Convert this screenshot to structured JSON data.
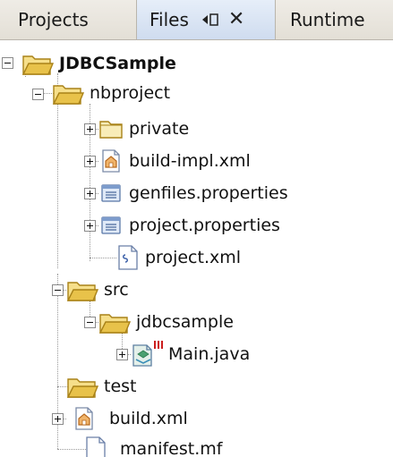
{
  "tabs": {
    "projects": "Projects",
    "files": "Files",
    "runtime": "Runtime",
    "close_glyph": "✕"
  },
  "tree": {
    "root": "JDBCSample",
    "nbproject": "nbproject",
    "private": "private",
    "build_impl": "build-impl.xml",
    "genfiles": "genfiles.properties",
    "project_properties": "project.properties",
    "project_xml": "project.xml",
    "src": "src",
    "jdbcsample": "jdbcsample",
    "main_java": "Main.java",
    "test": "test",
    "build_xml": "build.xml",
    "manifest": "manifest.mf"
  },
  "colors": {
    "folder": "#e8c24a",
    "folder_dark": "#a98218",
    "active_tab": "#cfdcef",
    "java_badge": "#cc1f1f"
  }
}
